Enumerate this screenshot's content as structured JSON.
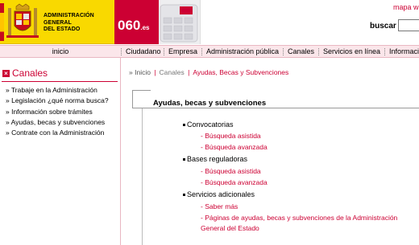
{
  "header": {
    "logo_text": "ADMINISTRACIÓN\nGENERAL\nDEL ESTADO",
    "brand_main": "060",
    "brand_suffix": ".es",
    "top_link": "mapa w",
    "search_label": "buscar",
    "search_value": ""
  },
  "nav": {
    "home": "inicio",
    "items": [
      "Ciudadano",
      "Empresa",
      "Administración pública",
      "Canales",
      "Servicios en línea",
      "Informaci"
    ]
  },
  "sidebar": {
    "title": "Canales",
    "items": [
      "» Trabaje en la Administración",
      "» Legislación ¿qué norma busca?",
      "» Información sobre trámites",
      "» Ayudas, becas y subvenciones",
      "» Contrate con la Administración"
    ]
  },
  "breadcrumb": {
    "prefix": "»",
    "home": "Inicio",
    "section": "Canales",
    "current": "Ayudas, Becas y Subvenciones"
  },
  "main": {
    "title": "Ayudas, becas y subvenciones",
    "sections": [
      {
        "label": "Convocatorias",
        "links": [
          "- Búsqueda asistida",
          "- Búsqueda avanzada"
        ]
      },
      {
        "label": "Bases reguladoras",
        "links": [
          "- Búsqueda asistida",
          "- Búsqueda avanzada"
        ]
      },
      {
        "label": "Servicios adicionales",
        "links": [
          "- Saber más",
          "- Páginas de ayudas, becas y subvenciones de la Administración General del Estado"
        ]
      }
    ]
  },
  "colors": {
    "accent": "#cc0033",
    "logo_bg": "#f9d900",
    "nav_bg": "#fbe6ea"
  }
}
